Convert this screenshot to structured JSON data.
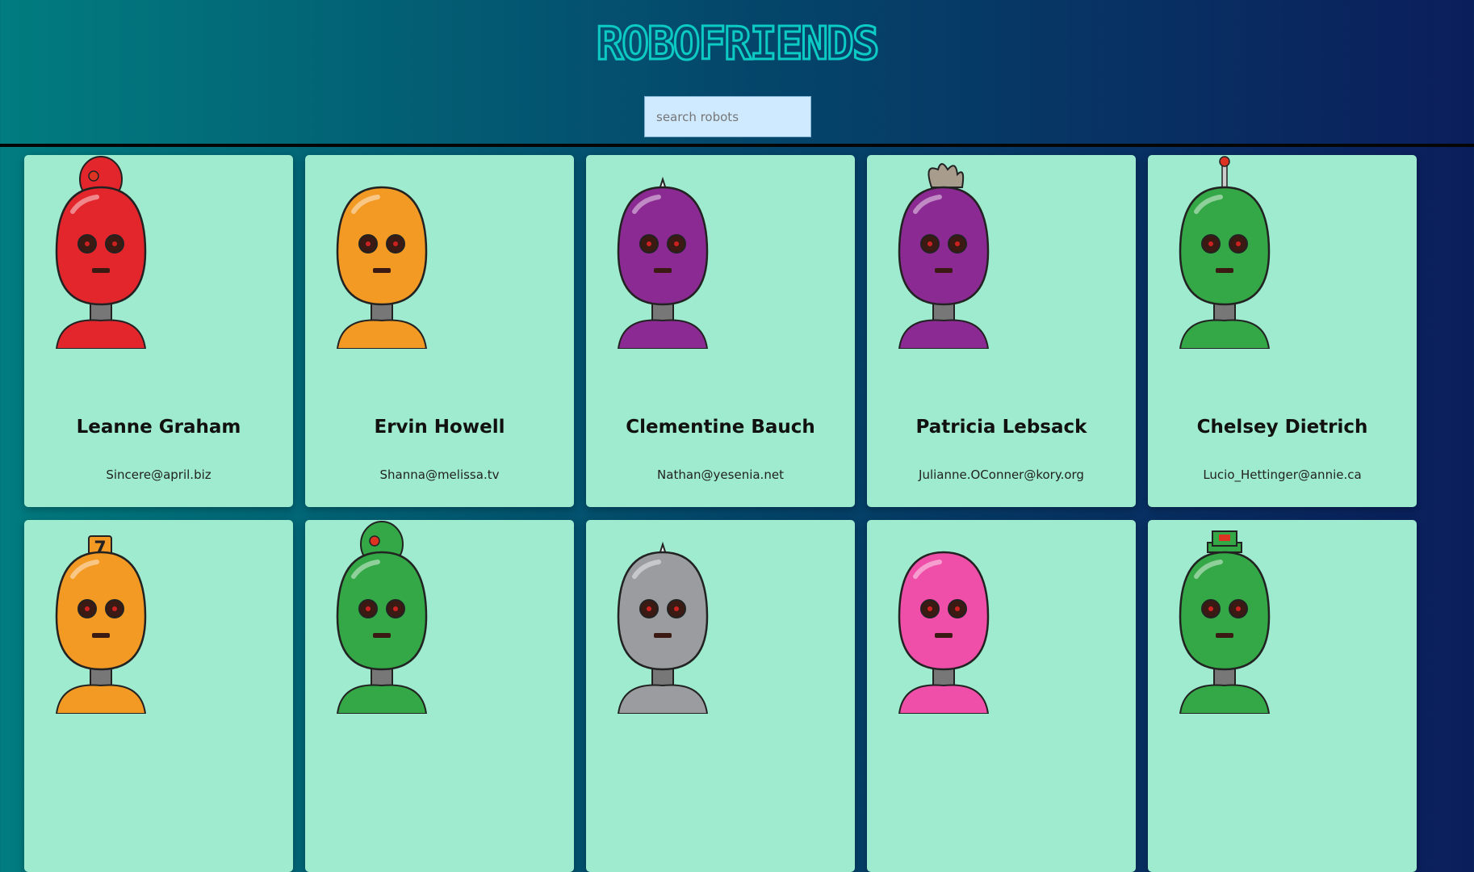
{
  "header": {
    "title": "ROBOFRIENDS"
  },
  "search": {
    "placeholder": "search robots",
    "value": ""
  },
  "colors": {
    "card_bg": "#9eebcf",
    "logo": "#0ccac4",
    "gradient_start": "#017c7f",
    "gradient_end": "#0b1e5c"
  },
  "robots": [
    {
      "name": "Leanne Graham",
      "email": "Sincere@april.biz",
      "color": "#e3252c",
      "antenna": "dome-red"
    },
    {
      "name": "Ervin Howell",
      "email": "Shanna@melissa.tv",
      "color": "#f39a24",
      "antenna": "none"
    },
    {
      "name": "Clementine Bauch",
      "email": "Nathan@yesenia.net",
      "color": "#8c2a94",
      "antenna": "spike"
    },
    {
      "name": "Patricia Lebsack",
      "email": "Julianne.OConner@kory.org",
      "color": "#8c2a94",
      "antenna": "hair"
    },
    {
      "name": "Chelsey Dietrich",
      "email": "Lucio_Hettinger@annie.ca",
      "color": "#34a846",
      "antenna": "rod"
    },
    {
      "name": "",
      "email": "",
      "color": "#f39a24",
      "antenna": "seven"
    },
    {
      "name": "",
      "email": "",
      "color": "#34a846",
      "antenna": "dome-green"
    },
    {
      "name": "",
      "email": "",
      "color": "#9a9ca0",
      "antenna": "spike"
    },
    {
      "name": "",
      "email": "",
      "color": "#ef4fa8",
      "antenna": "none"
    },
    {
      "name": "",
      "email": "",
      "color": "#34a846",
      "antenna": "hat"
    }
  ]
}
